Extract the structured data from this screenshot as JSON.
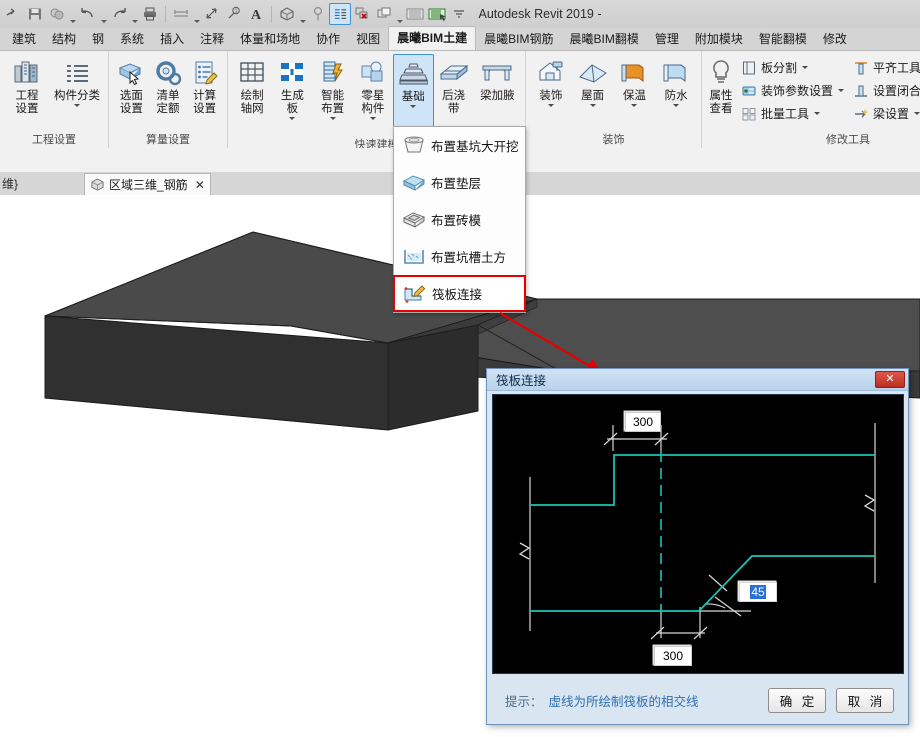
{
  "window": {
    "app_title": "Autodesk Revit 2019 - "
  },
  "quick_access": {
    "items": [
      {
        "name": "open-icon",
        "label": "打开"
      },
      {
        "name": "save-icon",
        "label": "保存"
      },
      {
        "name": "sync-icon",
        "label": "与中心文件同步"
      },
      {
        "name": "undo-icon",
        "label": "放弃"
      },
      {
        "name": "redo-icon",
        "label": "重做"
      },
      {
        "name": "print-icon",
        "label": "打印"
      },
      {
        "name": "measure-icon",
        "label": "测量"
      },
      {
        "name": "aligned-dimension-icon",
        "label": "对齐尺寸标注"
      },
      {
        "name": "tag-icon",
        "label": "按类别标记"
      },
      {
        "name": "text-icon",
        "label": "文字"
      },
      {
        "name": "default-3d-view-icon",
        "label": "默认三维视图"
      },
      {
        "name": "section-icon",
        "label": "剖面"
      },
      {
        "name": "thin-lines-icon",
        "label": "细线"
      },
      {
        "name": "close-hidden-windows-icon",
        "label": "关闭非活动窗口"
      },
      {
        "name": "switch-windows-icon",
        "label": "切换窗口"
      },
      {
        "name": "ribbon-gallery-icon",
        "label": "功能区库"
      },
      {
        "name": "ribbon-gallery-active-icon",
        "label": "库"
      },
      {
        "name": "customize-qat-icon",
        "label": "自定义快速访问工具栏"
      }
    ]
  },
  "ribbon": {
    "tabs": [
      {
        "label": "建筑",
        "active": false
      },
      {
        "label": "结构",
        "active": false
      },
      {
        "label": "钢",
        "active": false
      },
      {
        "label": "系统",
        "active": false
      },
      {
        "label": "插入",
        "active": false
      },
      {
        "label": "注释",
        "active": false
      },
      {
        "label": "体量和场地",
        "active": false
      },
      {
        "label": "协作",
        "active": false
      },
      {
        "label": "视图",
        "active": false
      },
      {
        "label": "晨曦BIM土建",
        "active": true
      },
      {
        "label": "晨曦BIM钢筋",
        "active": false
      },
      {
        "label": "晨曦BIM翻模",
        "active": false
      },
      {
        "label": "管理",
        "active": false
      },
      {
        "label": "附加模块",
        "active": false
      },
      {
        "label": "智能翻模",
        "active": false
      },
      {
        "label": "修改",
        "active": false
      }
    ],
    "panels": [
      {
        "title": "工程设置",
        "buttons": [
          {
            "label1": "工程",
            "label2": "设置",
            "icon": "project-settings-icon",
            "dropdown": false
          },
          {
            "label1": "构件分类",
            "label2": "",
            "icon": "component-classification-icon",
            "dropdown": true
          }
        ]
      },
      {
        "title": "算量设置",
        "buttons": [
          {
            "label1": "选面",
            "label2": "设置",
            "icon": "face-selection-icon",
            "dropdown": false
          },
          {
            "label1": "清单",
            "label2": "定额",
            "icon": "quota-icon",
            "dropdown": false
          },
          {
            "label1": "计算",
            "label2": "设置",
            "icon": "calc-settings-icon",
            "dropdown": false
          }
        ]
      },
      {
        "title": "快速建模",
        "buttons": [
          {
            "label1": "绘制",
            "label2": "轴网",
            "icon": "draw-grid-icon",
            "dropdown": false
          },
          {
            "label1": "生成",
            "label2": "板",
            "icon": "generate-slab-icon",
            "dropdown": true
          },
          {
            "label1": "智能",
            "label2": "布置",
            "icon": "smart-layout-icon",
            "dropdown": true
          },
          {
            "label1": "零星",
            "label2": "构件",
            "icon": "misc-component-icon",
            "dropdown": true
          },
          {
            "label1": "基础",
            "label2": "",
            "icon": "foundation-icon",
            "dropdown": true,
            "selected": true
          },
          {
            "label1": "后浇",
            "label2": "带",
            "icon": "post-cast-strip-icon",
            "dropdown": false
          },
          {
            "label1": "梁加腋",
            "label2": "",
            "icon": "beam-haunch-icon",
            "dropdown": false
          }
        ]
      },
      {
        "title": "装饰",
        "buttons": [
          {
            "label1": "装饰",
            "label2": "",
            "icon": "decoration-icon",
            "dropdown": true
          },
          {
            "label1": "屋面",
            "label2": "",
            "icon": "roof-icon",
            "dropdown": true
          },
          {
            "label1": "保温",
            "label2": "",
            "icon": "insulation-icon",
            "dropdown": true
          },
          {
            "label1": "防水",
            "label2": "",
            "icon": "waterproof-icon",
            "dropdown": true
          }
        ]
      },
      {
        "title": "修改工具",
        "buttons": [
          {
            "label1": "属性",
            "label2": "查看",
            "icon": "property-view-icon",
            "dropdown": false
          }
        ],
        "small_groups": [
          [
            {
              "label": "板分割",
              "icon": "slab-split-icon",
              "dropdown": true
            },
            {
              "label": "装饰参数设置",
              "icon": "decoration-params-icon",
              "dropdown": true
            },
            {
              "label": "批量工具",
              "icon": "batch-tools-icon",
              "dropdown": true
            }
          ],
          [
            {
              "label": "平齐工具",
              "icon": "align-tool-icon",
              "dropdown": false
            },
            {
              "label": "设置闭合",
              "icon": "set-closure-icon",
              "dropdown": false
            },
            {
              "label": "梁设置",
              "icon": "beam-settings-icon",
              "dropdown": true
            }
          ]
        ]
      }
    ]
  },
  "view_tabs": {
    "truncated_label": "维}",
    "active_tab": {
      "label": "区域三维_钢筋",
      "close": "✕",
      "icon": "home-3d-icon"
    }
  },
  "foundation_menu": {
    "items": [
      {
        "label": "布置基坑大开挖",
        "icon": "pit-excavation-icon",
        "highlighted": false
      },
      {
        "label": "布置垫层",
        "icon": "cushion-layer-icon",
        "highlighted": false
      },
      {
        "label": "布置砖模",
        "icon": "brick-form-icon",
        "highlighted": false
      },
      {
        "label": "布置坑槽土方",
        "icon": "trench-earthwork-icon",
        "highlighted": false
      },
      {
        "label": "筏板连接",
        "icon": "raft-connection-icon",
        "highlighted": true
      }
    ],
    "highlight_color": "#e60000"
  },
  "dialog": {
    "title": "筏板连接",
    "close_glyph": "✕",
    "hint_label": "提示：",
    "hint_text": "虚线为所绘制筏板的相交线",
    "ok_label": "确 定",
    "cancel_label": "取 消",
    "diagram": {
      "stroke_color": "#19c4b4",
      "annotation_color": "#d8d8d8",
      "background": "#000000",
      "dim_top": "300",
      "dim_bottom": "300",
      "angle": "45"
    }
  },
  "model": {
    "name": "raft-slab-3d-model",
    "face_top_color": "#4a4a4a",
    "face_front_color": "#2e2e2e",
    "face_side_color": "#3c3c3c"
  }
}
